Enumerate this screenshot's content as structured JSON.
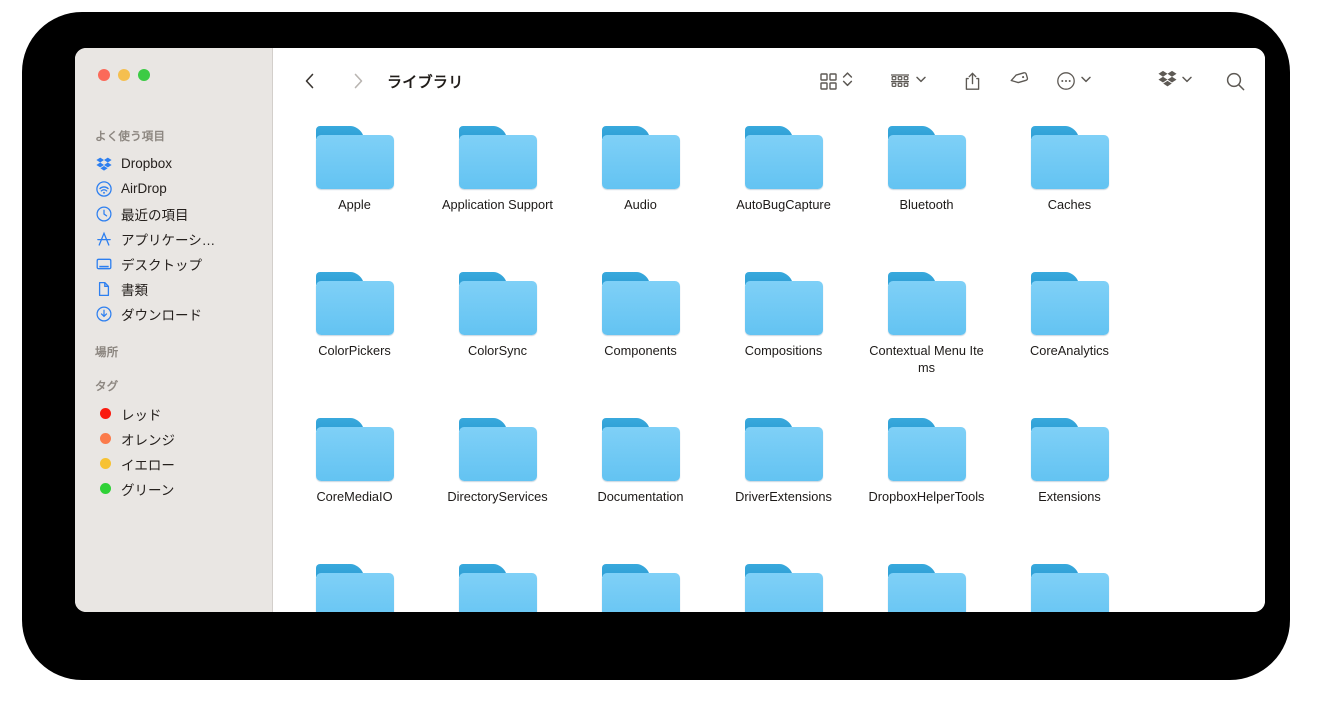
{
  "window": {
    "title": "ライブラリ",
    "traffic_lights": [
      {
        "name": "close",
        "color": "#fb6a5a"
      },
      {
        "name": "minimize",
        "color": "#f5bf4f"
      },
      {
        "name": "maximize",
        "color": "#3ccb45"
      }
    ]
  },
  "toolbar": {
    "back_label": "‹",
    "forward_label": "›",
    "icons": [
      {
        "name": "icon-view-icon",
        "label": "grid-view"
      },
      {
        "name": "view-sort-chevrons-icon",
        "label": "sort"
      },
      {
        "name": "group-by-icon",
        "label": "group-items"
      },
      {
        "name": "group-by-chevron-icon",
        "label": "chevron-down"
      },
      {
        "name": "share-icon",
        "label": "share"
      },
      {
        "name": "tag-icon",
        "label": "tag"
      },
      {
        "name": "more-actions-icon",
        "label": "more"
      },
      {
        "name": "more-actions-chevron-icon",
        "label": "chevron-down"
      },
      {
        "name": "dropbox-icon",
        "label": "dropbox"
      },
      {
        "name": "dropbox-chevron-icon",
        "label": "chevron-down"
      },
      {
        "name": "search-icon",
        "label": "search"
      }
    ]
  },
  "sidebar": {
    "groups": [
      {
        "title": "よく使う項目",
        "items": [
          {
            "label": "Dropbox",
            "icon": "dropbox-icon"
          },
          {
            "label": "AirDrop",
            "icon": "airdrop-icon"
          },
          {
            "label": "最近の項目",
            "icon": "clock-icon"
          },
          {
            "label": "アプリケーシ…",
            "icon": "applications-icon"
          },
          {
            "label": "デスクトップ",
            "icon": "desktop-icon"
          },
          {
            "label": "書類",
            "icon": "document-icon"
          },
          {
            "label": "ダウンロード",
            "icon": "downloads-icon"
          }
        ]
      },
      {
        "title": "場所",
        "items": []
      },
      {
        "title": "タグ",
        "items": [
          {
            "label": "レッド",
            "icon": "tag-dot-icon",
            "color": "#fa1b0f"
          },
          {
            "label": "オレンジ",
            "icon": "tag-dot-icon",
            "color": "#fb7b4b"
          },
          {
            "label": "イエロー",
            "icon": "tag-dot-icon",
            "color": "#f7c233"
          },
          {
            "label": "グリーン",
            "icon": "tag-dot-icon",
            "color": "#2fd137"
          }
        ]
      }
    ]
  },
  "main": {
    "folder_color": "#63c3f2",
    "rows": [
      [
        "Apple",
        "Application Support",
        "Audio",
        "AutoBugCapture",
        "Bluetooth",
        "Caches"
      ],
      [
        "ColorPickers",
        "ColorSync",
        "Components",
        "Compositions",
        "Contextual Menu Items",
        "CoreAnalytics"
      ],
      [
        "CoreMediaIO",
        "DirectoryServices",
        "Documentation",
        "DriverExtensions",
        "DropboxHelperTools",
        "Extensions"
      ],
      [
        "",
        "",
        "",
        "",
        "",
        ""
      ]
    ]
  }
}
